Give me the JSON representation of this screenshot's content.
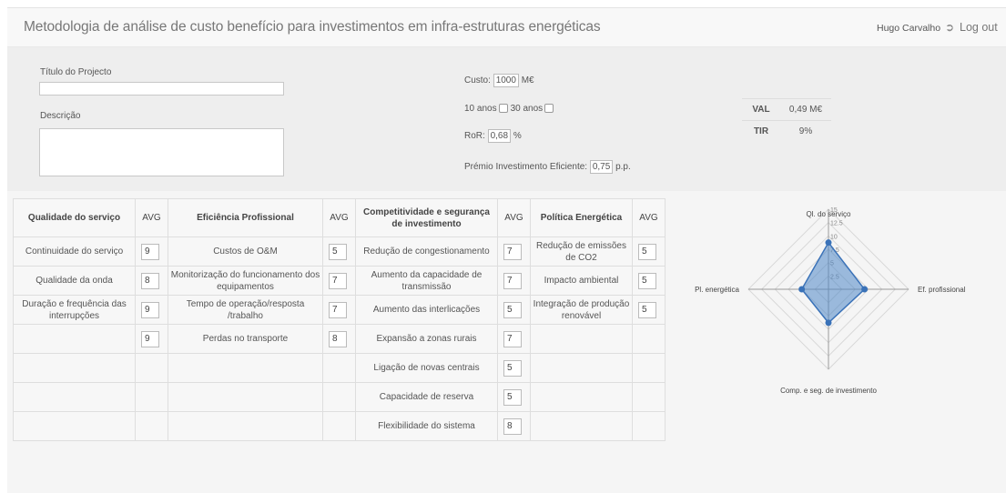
{
  "navbar": {
    "title": "Metodologia de análise de custo benefício para investimentos em infra-estruturas energéticas",
    "user": "Hugo Carvalho",
    "logout_label": "Log out",
    "logout_icon": "sign-out-icon"
  },
  "project": {
    "title_label": "Título do Projecto",
    "title_value": "",
    "description_label": "Descrição",
    "description_value": ""
  },
  "params": {
    "cost_label": "Custo:",
    "cost_value": "1000",
    "cost_unit": "M€",
    "period_10_label": "10 anos",
    "period_30_label": "30 anos",
    "ror_label": "RoR:",
    "ror_value": "0,68",
    "ror_unit": "%",
    "premium_label": "Prémio Investimento Eficiente:",
    "premium_value": "0,75",
    "premium_unit": "p.p."
  },
  "results": {
    "val_label": "VAL",
    "val_value": "0,49 M€",
    "tir_label": "TIR",
    "tir_value": "9%"
  },
  "criteria": {
    "avg_label": "AVG",
    "groups": [
      {
        "title": "Qualidade do serviço",
        "items": [
          {
            "label": "Continuidade do serviço",
            "value": "9"
          },
          {
            "label": "Qualidade da onda",
            "value": "8"
          },
          {
            "label": "Duração e frequência das interrupções",
            "value": "9"
          },
          {
            "label": "",
            "value": "9"
          }
        ]
      },
      {
        "title": "Eficiência Profissional",
        "items": [
          {
            "label": "Custos de O&M",
            "value": "5"
          },
          {
            "label": "Monitorização do funcionamento dos equipamentos",
            "value": "7"
          },
          {
            "label": "Tempo de operação/resposta /trabalho",
            "value": "7"
          },
          {
            "label": "Perdas no transporte",
            "value": "8"
          }
        ]
      },
      {
        "title": "Competitividade e segurança de investimento",
        "items": [
          {
            "label": "Redução de congestionamento",
            "value": "7"
          },
          {
            "label": "Aumento da capacidade de transmissão",
            "value": "7"
          },
          {
            "label": "Aumento das interlicações",
            "value": "5"
          },
          {
            "label": "Expansão a zonas rurais",
            "value": "7"
          },
          {
            "label": "Ligação de novas centrais",
            "value": "5"
          },
          {
            "label": "Capacidade de reserva",
            "value": "5"
          },
          {
            "label": "Flexibilidade do sistema",
            "value": "8"
          }
        ]
      },
      {
        "title": "Política Energética",
        "items": [
          {
            "label": "Redução de emissões de CO2",
            "value": "5"
          },
          {
            "label": "Impacto ambiental",
            "value": "5"
          },
          {
            "label": "Integração de produção renovável",
            "value": "5"
          }
        ]
      }
    ]
  },
  "chart_data": {
    "type": "radar",
    "axes": [
      "Ql. do serviço",
      "Ef. profissional",
      "Comp. e seg. de investimento",
      "Pl. energética"
    ],
    "values": [
      8.75,
      6.75,
      6.29,
      5
    ],
    "rmax": 15,
    "ticks": [
      "15",
      "12.5",
      "10",
      "7.5",
      "5",
      "2.5"
    ],
    "tick_values": [
      15,
      12.5,
      10,
      7.5,
      5,
      2.5
    ],
    "fill_color": "#4f86c6",
    "line_color": "#3a72b8",
    "grid": true
  }
}
